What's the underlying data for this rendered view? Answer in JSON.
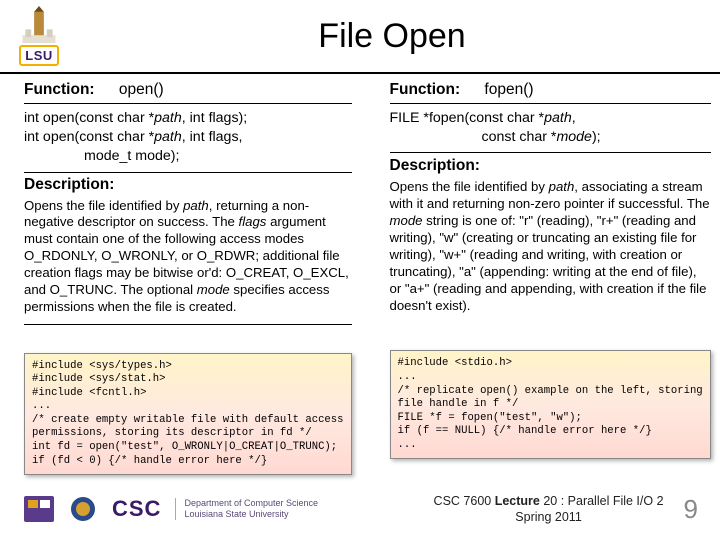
{
  "header": {
    "title": "File Open",
    "logo_text": "LSU"
  },
  "left": {
    "fn_label": "Function:",
    "fn_name": "open()",
    "sig_line1_a": "int open(const char *",
    "sig_line1_b": "path",
    "sig_line1_c": ", int flags);",
    "sig_line2_a": "int open(const char *",
    "sig_line2_b": "path",
    "sig_line2_c": ", int flags,",
    "sig_line3": "mode_t mode);",
    "desc_hdr": "Description:",
    "desc_a": "Opens the file identified by ",
    "desc_path": "path",
    "desc_b": ", returning a non-negative descriptor on success. The ",
    "desc_flags": "flags",
    "desc_c": " argument must contain one of the following access modes O_RDONLY, O_WRONLY, or O_RDWR; additional file creation flags may be bitwise or'd: O_CREAT, O_EXCL, and O_TRUNC. The optional ",
    "desc_mode": "mode",
    "desc_d": " specifies access permissions when the file is created.",
    "code": "#include <sys/types.h>\n#include <sys/stat.h>\n#include <fcntl.h>\n...\n/* create empty writable file with default access\npermissions, storing its descriptor in fd */\nint fd = open(\"test\", O_WRONLY|O_CREAT|O_TRUNC);\nif (fd < 0) {/* handle error here */}"
  },
  "right": {
    "fn_label": "Function:",
    "fn_name": "fopen()",
    "sig_line1_a": "FILE *fopen(const char *",
    "sig_line1_b": "path",
    "sig_line1_c": ",",
    "sig_line2_a": "const char *",
    "sig_line2_b": "mode",
    "sig_line2_c": ");",
    "desc_hdr": "Description:",
    "desc_a": "Opens the file identified by ",
    "desc_path": "path",
    "desc_b": ", associating a stream with it and returning non-zero pointer if successful. The ",
    "desc_mode": "mode",
    "desc_c": " string is one of: \"r\" (reading), \"r+\" (reading and writing), \"w\" (creating or truncating an existing file for writing), \"w+\" (reading and writing, with creation or truncating), \"a\" (appending: writing at the end of file), or \"a+\" (reading and appending, with creation if the file doesn't exist).",
    "code": "#include <stdio.h>\n...\n/* replicate open() example on the left, storing\nfile handle in f */\nFILE *f = fopen(\"test\", \"w\");\nif (f == NULL) {/* handle error here */}\n..."
  },
  "footer": {
    "csc": "CSC",
    "dept1": "Department of Computer Science",
    "dept2": "Louisiana State University",
    "lecture_a": "CSC 7600 ",
    "lecture_b": "Lecture",
    "lecture_c": " 20 : Parallel File I/O 2",
    "term": "Spring 2011",
    "num": "9"
  }
}
